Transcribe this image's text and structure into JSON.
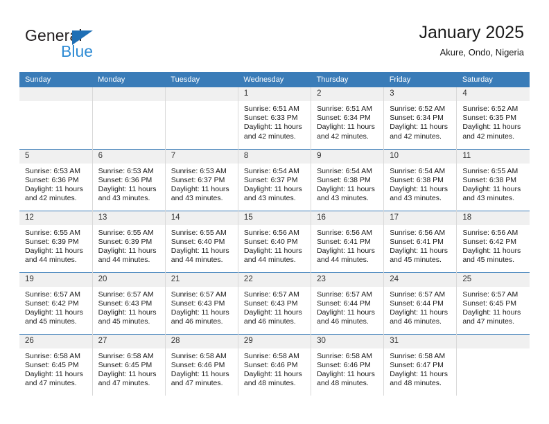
{
  "brand": {
    "name_part1": "General",
    "name_part2": "Blue",
    "triangle_icon": "triangle-icon"
  },
  "header": {
    "title": "January 2025",
    "subtitle": "Akure, Ondo, Nigeria",
    "accent_color": "#3a7cb8",
    "brand_blue": "#2e8bd4"
  },
  "calendar": {
    "weekday_headers": [
      "Sunday",
      "Monday",
      "Tuesday",
      "Wednesday",
      "Thursday",
      "Friday",
      "Saturday"
    ],
    "labels": {
      "sunrise": "Sunrise:",
      "sunset": "Sunset:",
      "daylight": "Daylight:"
    },
    "weeks": [
      [
        {
          "day": "",
          "empty": true
        },
        {
          "day": "",
          "empty": true
        },
        {
          "day": "",
          "empty": true
        },
        {
          "day": "1",
          "sunrise": "Sunrise: 6:51 AM",
          "sunset": "Sunset: 6:33 PM",
          "daylight_1": "Daylight: 11 hours",
          "daylight_2": "and 42 minutes."
        },
        {
          "day": "2",
          "sunrise": "Sunrise: 6:51 AM",
          "sunset": "Sunset: 6:34 PM",
          "daylight_1": "Daylight: 11 hours",
          "daylight_2": "and 42 minutes."
        },
        {
          "day": "3",
          "sunrise": "Sunrise: 6:52 AM",
          "sunset": "Sunset: 6:34 PM",
          "daylight_1": "Daylight: 11 hours",
          "daylight_2": "and 42 minutes."
        },
        {
          "day": "4",
          "sunrise": "Sunrise: 6:52 AM",
          "sunset": "Sunset: 6:35 PM",
          "daylight_1": "Daylight: 11 hours",
          "daylight_2": "and 42 minutes."
        }
      ],
      [
        {
          "day": "5",
          "sunrise": "Sunrise: 6:53 AM",
          "sunset": "Sunset: 6:36 PM",
          "daylight_1": "Daylight: 11 hours",
          "daylight_2": "and 42 minutes."
        },
        {
          "day": "6",
          "sunrise": "Sunrise: 6:53 AM",
          "sunset": "Sunset: 6:36 PM",
          "daylight_1": "Daylight: 11 hours",
          "daylight_2": "and 43 minutes."
        },
        {
          "day": "7",
          "sunrise": "Sunrise: 6:53 AM",
          "sunset": "Sunset: 6:37 PM",
          "daylight_1": "Daylight: 11 hours",
          "daylight_2": "and 43 minutes."
        },
        {
          "day": "8",
          "sunrise": "Sunrise: 6:54 AM",
          "sunset": "Sunset: 6:37 PM",
          "daylight_1": "Daylight: 11 hours",
          "daylight_2": "and 43 minutes."
        },
        {
          "day": "9",
          "sunrise": "Sunrise: 6:54 AM",
          "sunset": "Sunset: 6:38 PM",
          "daylight_1": "Daylight: 11 hours",
          "daylight_2": "and 43 minutes."
        },
        {
          "day": "10",
          "sunrise": "Sunrise: 6:54 AM",
          "sunset": "Sunset: 6:38 PM",
          "daylight_1": "Daylight: 11 hours",
          "daylight_2": "and 43 minutes."
        },
        {
          "day": "11",
          "sunrise": "Sunrise: 6:55 AM",
          "sunset": "Sunset: 6:38 PM",
          "daylight_1": "Daylight: 11 hours",
          "daylight_2": "and 43 minutes."
        }
      ],
      [
        {
          "day": "12",
          "sunrise": "Sunrise: 6:55 AM",
          "sunset": "Sunset: 6:39 PM",
          "daylight_1": "Daylight: 11 hours",
          "daylight_2": "and 44 minutes."
        },
        {
          "day": "13",
          "sunrise": "Sunrise: 6:55 AM",
          "sunset": "Sunset: 6:39 PM",
          "daylight_1": "Daylight: 11 hours",
          "daylight_2": "and 44 minutes."
        },
        {
          "day": "14",
          "sunrise": "Sunrise: 6:55 AM",
          "sunset": "Sunset: 6:40 PM",
          "daylight_1": "Daylight: 11 hours",
          "daylight_2": "and 44 minutes."
        },
        {
          "day": "15",
          "sunrise": "Sunrise: 6:56 AM",
          "sunset": "Sunset: 6:40 PM",
          "daylight_1": "Daylight: 11 hours",
          "daylight_2": "and 44 minutes."
        },
        {
          "day": "16",
          "sunrise": "Sunrise: 6:56 AM",
          "sunset": "Sunset: 6:41 PM",
          "daylight_1": "Daylight: 11 hours",
          "daylight_2": "and 44 minutes."
        },
        {
          "day": "17",
          "sunrise": "Sunrise: 6:56 AM",
          "sunset": "Sunset: 6:41 PM",
          "daylight_1": "Daylight: 11 hours",
          "daylight_2": "and 45 minutes."
        },
        {
          "day": "18",
          "sunrise": "Sunrise: 6:56 AM",
          "sunset": "Sunset: 6:42 PM",
          "daylight_1": "Daylight: 11 hours",
          "daylight_2": "and 45 minutes."
        }
      ],
      [
        {
          "day": "19",
          "sunrise": "Sunrise: 6:57 AM",
          "sunset": "Sunset: 6:42 PM",
          "daylight_1": "Daylight: 11 hours",
          "daylight_2": "and 45 minutes."
        },
        {
          "day": "20",
          "sunrise": "Sunrise: 6:57 AM",
          "sunset": "Sunset: 6:43 PM",
          "daylight_1": "Daylight: 11 hours",
          "daylight_2": "and 45 minutes."
        },
        {
          "day": "21",
          "sunrise": "Sunrise: 6:57 AM",
          "sunset": "Sunset: 6:43 PM",
          "daylight_1": "Daylight: 11 hours",
          "daylight_2": "and 46 minutes."
        },
        {
          "day": "22",
          "sunrise": "Sunrise: 6:57 AM",
          "sunset": "Sunset: 6:43 PM",
          "daylight_1": "Daylight: 11 hours",
          "daylight_2": "and 46 minutes."
        },
        {
          "day": "23",
          "sunrise": "Sunrise: 6:57 AM",
          "sunset": "Sunset: 6:44 PM",
          "daylight_1": "Daylight: 11 hours",
          "daylight_2": "and 46 minutes."
        },
        {
          "day": "24",
          "sunrise": "Sunrise: 6:57 AM",
          "sunset": "Sunset: 6:44 PM",
          "daylight_1": "Daylight: 11 hours",
          "daylight_2": "and 46 minutes."
        },
        {
          "day": "25",
          "sunrise": "Sunrise: 6:57 AM",
          "sunset": "Sunset: 6:45 PM",
          "daylight_1": "Daylight: 11 hours",
          "daylight_2": "and 47 minutes."
        }
      ],
      [
        {
          "day": "26",
          "sunrise": "Sunrise: 6:58 AM",
          "sunset": "Sunset: 6:45 PM",
          "daylight_1": "Daylight: 11 hours",
          "daylight_2": "and 47 minutes."
        },
        {
          "day": "27",
          "sunrise": "Sunrise: 6:58 AM",
          "sunset": "Sunset: 6:45 PM",
          "daylight_1": "Daylight: 11 hours",
          "daylight_2": "and 47 minutes."
        },
        {
          "day": "28",
          "sunrise": "Sunrise: 6:58 AM",
          "sunset": "Sunset: 6:46 PM",
          "daylight_1": "Daylight: 11 hours",
          "daylight_2": "and 47 minutes."
        },
        {
          "day": "29",
          "sunrise": "Sunrise: 6:58 AM",
          "sunset": "Sunset: 6:46 PM",
          "daylight_1": "Daylight: 11 hours",
          "daylight_2": "and 48 minutes."
        },
        {
          "day": "30",
          "sunrise": "Sunrise: 6:58 AM",
          "sunset": "Sunset: 6:46 PM",
          "daylight_1": "Daylight: 11 hours",
          "daylight_2": "and 48 minutes."
        },
        {
          "day": "31",
          "sunrise": "Sunrise: 6:58 AM",
          "sunset": "Sunset: 6:47 PM",
          "daylight_1": "Daylight: 11 hours",
          "daylight_2": "and 48 minutes."
        },
        {
          "day": "",
          "empty": true
        }
      ]
    ]
  }
}
